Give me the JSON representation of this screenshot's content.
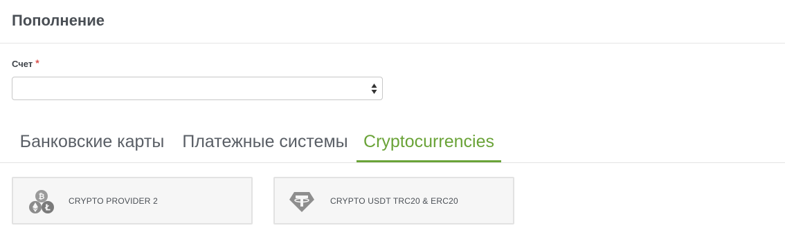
{
  "page": {
    "title": "Пополнение"
  },
  "form": {
    "account": {
      "label": "Счет",
      "required_mark": "*",
      "value": ""
    }
  },
  "tabs": [
    {
      "label": "Банковские карты",
      "active": false
    },
    {
      "label": "Платежные системы",
      "active": false
    },
    {
      "label": "Cryptocurrencies",
      "active": true
    }
  ],
  "providers": [
    {
      "label": "CRYPTO PROVIDER 2",
      "icon": "multi-crypto-coins-icon"
    },
    {
      "label": "CRYPTO USDT TRC20 & ERC20",
      "icon": "tether-icon"
    }
  ],
  "colors": {
    "accent": "#6aa338",
    "required": "#d9534f",
    "text": "#4a4f55",
    "card_bg": "#f6f6f6"
  }
}
